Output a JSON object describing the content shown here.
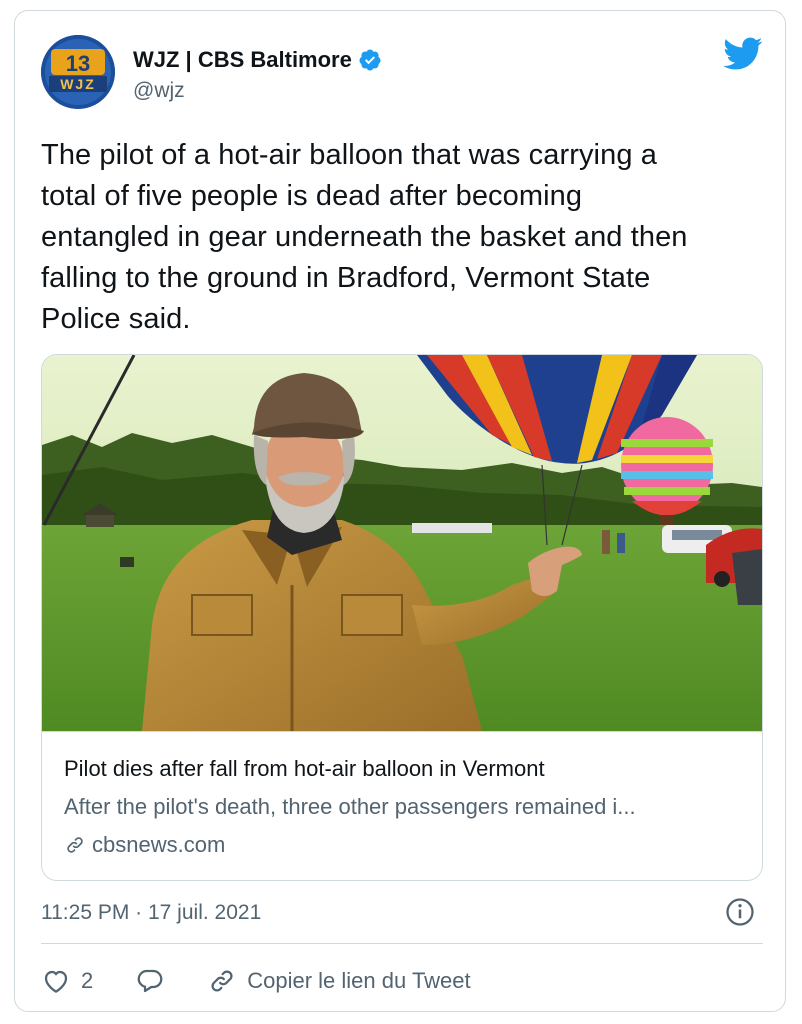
{
  "account": {
    "display_name": "WJZ | CBS Baltimore",
    "handle": "@wjz",
    "avatar_text_top": "13",
    "avatar_text_bottom": "WJZ",
    "verified_icon": "verified-badge-icon",
    "brand_icon": "twitter-bird-icon"
  },
  "tweet": {
    "text": "The pilot of a hot-air balloon that was carrying a\ntotal of five people is dead after becoming\nentangled in gear underneath the basket and then\nfalling to the ground in Bradford, Vermont State\nPolice said."
  },
  "link_card": {
    "title": "Pilot dies after fall from hot-air balloon in Vermont",
    "description": "After the pilot's death, three other passengers remained i...",
    "domain": "cbsnews.com",
    "domain_icon": "link-icon"
  },
  "meta": {
    "timestamp": "11:25 PM · 17 juil. 2021",
    "info_icon": "info-icon"
  },
  "actions": {
    "like_count": "2",
    "copy_link_label": "Copier le lien du Tweet"
  },
  "colors": {
    "text_primary": "#0f1419",
    "text_secondary": "#536471",
    "border": "#cfd9de",
    "twitter_blue": "#1d9bf0"
  }
}
